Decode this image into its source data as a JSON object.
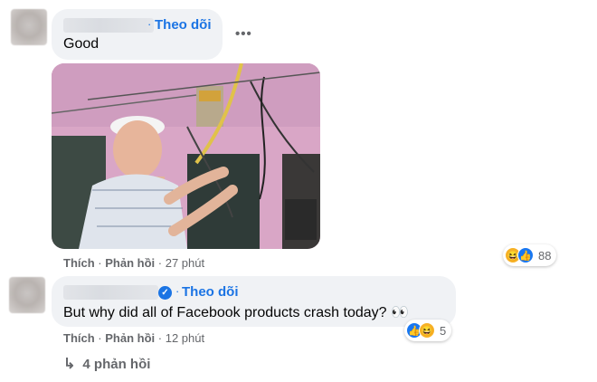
{
  "comment1": {
    "follow_label": "Theo dõi",
    "text": "Good",
    "more_label": "•••",
    "actions": {
      "like": "Thích",
      "reply": "Phản hồi",
      "time": "27 phút"
    },
    "reactions": {
      "icons": [
        "haha-icon",
        "like-icon"
      ],
      "count": "88"
    }
  },
  "comment2": {
    "follow_label": "Theo dõi",
    "text": "But why did all of Facebook products crash today? 👀",
    "actions": {
      "like": "Thích",
      "reply": "Phản hồi",
      "time": "12 phút"
    },
    "reactions": {
      "icons": [
        "like-icon",
        "haha-icon"
      ],
      "count": "5"
    }
  },
  "replies": {
    "label": "4 phản hồi"
  },
  "colors": {
    "link_blue": "#1b74e4",
    "bubble": "#f0f2f5",
    "muted": "#65676b"
  }
}
